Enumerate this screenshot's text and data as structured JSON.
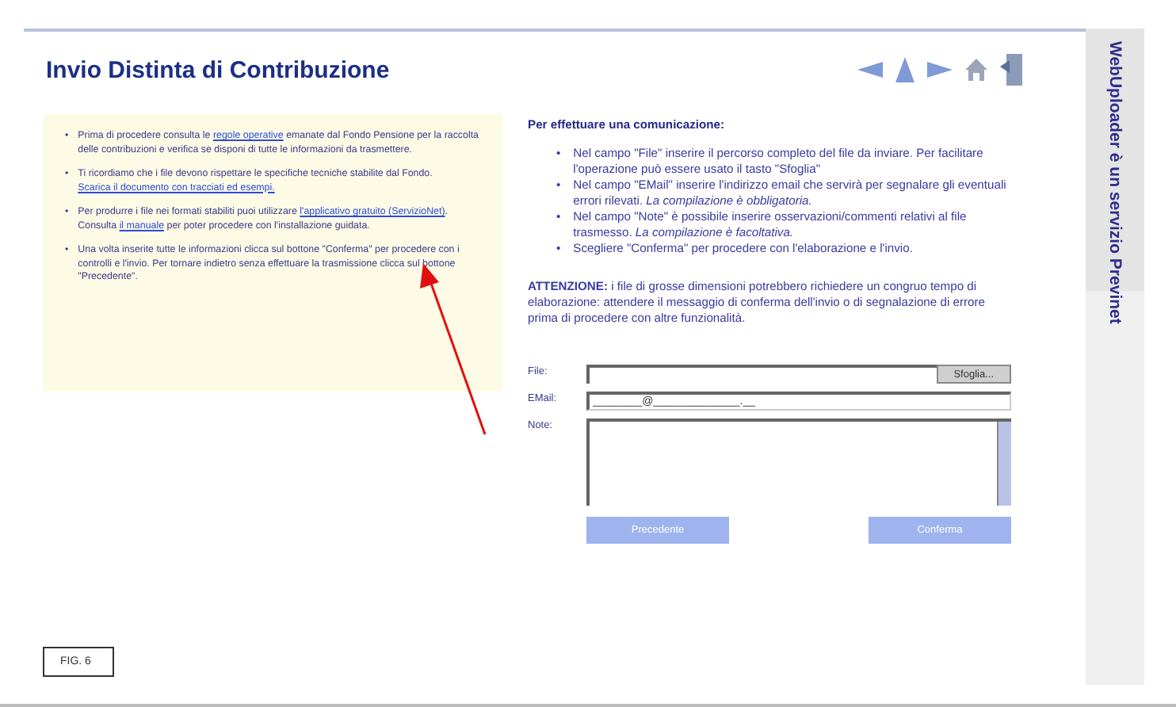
{
  "page": {
    "title": "Invio Distinta di Contribuzione",
    "sidebar_text": "WebUploader è un servizio Previnet"
  },
  "nav_icons": [
    {
      "kind": "back"
    },
    {
      "kind": "up"
    },
    {
      "kind": "forward"
    },
    {
      "kind": "home"
    },
    {
      "kind": "exit"
    }
  ],
  "info_box": {
    "marker": "•",
    "items": [
      [
        {
          "text": "Prima di procedere consulta le ",
          "link": false
        },
        {
          "text": "regole operative",
          "link": true
        },
        {
          "text": " emanate dal Fondo Pensione per la raccolta delle contribuzioni e verifica se disponi di tutte le informazioni da trasmettere.",
          "link": false
        }
      ],
      [
        {
          "text": "Ti ricordiamo che i file devono rispettare le specifiche tecniche stabilite dal Fondo. ",
          "link": false
        },
        {
          "text": "Scarica il documento con tracciati ed esempi.",
          "link": true
        }
      ],
      [
        {
          "text": "Per produrre i file nei formati stabiliti puoi utilizzare ",
          "link": false
        },
        {
          "text": "l'applicativo gratuito (ServizioNet)",
          "link": true
        },
        {
          "text": ". Consulta ",
          "link": false
        },
        {
          "text": "il manuale",
          "link": true
        },
        {
          "text": " per poter procedere con l'installazione guidata.",
          "link": false
        }
      ],
      [
        {
          "text": "Una volta inserite tutte le informazioni clicca sul bottone \"Conferma\" per procedere con i controlli e l'invio. Per tornare indietro senza effettuare la trasmissione clicca sul bottone \"Precedente\".",
          "link": false
        }
      ]
    ]
  },
  "instructions": {
    "heading": "Per effettuare una comunicazione:",
    "marker": "•",
    "items": [
      "Nel campo \"File\" inserire il percorso completo del file da inviare. Per facilitare l'operazione può essere usato il tasto \"Sfoglia\"",
      "Nel campo \"EMail\" inserire l'indirizzo email che servirà per segnalare gli eventuali errori rilevati. *La compilazione è obbligatoria.*",
      "Nel campo \"Note\" è possibile inserire osservazioni/commenti relativi al file trasmesso. *La compilazione è facoltativa.*",
      "Scegliere \"Conferma\" per procedere con l'elaborazione e l'invio."
    ],
    "warning": "**ATTENZIONE:** i file di grosse dimensioni potrebbero richiedere un congruo tempo di elaborazione: attendere il messaggio di conferma dell'invio o di segnalazione di errore prima di procedere con altre funzionalità."
  },
  "form": {
    "fields": [
      {
        "kind": "file",
        "label": "File:",
        "button": "Sfoglia..."
      },
      {
        "kind": "text",
        "label": "EMail:",
        "value": "________@______________.__"
      },
      {
        "kind": "textarea",
        "label": "Note:"
      }
    ],
    "buttons": [
      "Precedente",
      "Conferma"
    ]
  },
  "figure_label": "FIG. 6"
}
